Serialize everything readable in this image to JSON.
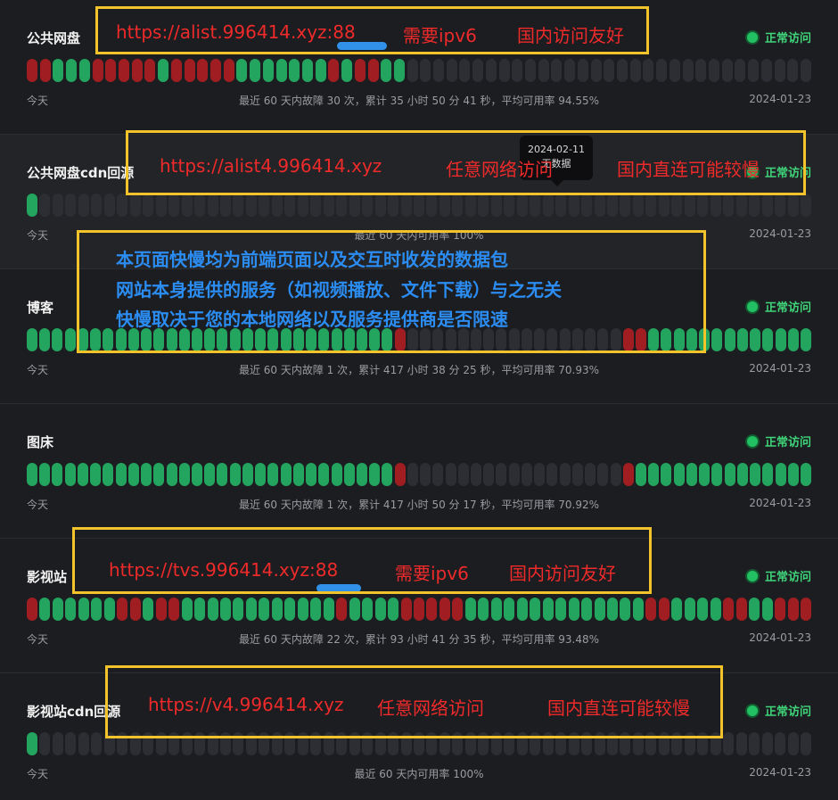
{
  "colors": {
    "up": "#23a45f",
    "down": "#a01e22",
    "nodata": "#2c2e33",
    "status": "#3fd47a",
    "annotation": "#ee2a2a",
    "note": "#2b8cf2",
    "box": "#f3c32b"
  },
  "monitors": [
    {
      "name": "公共网盘",
      "status": "正常访问",
      "today": "今天",
      "summary": "最近 60 天内故障 30 次，累计 35 小时 50 分 41 秒，平均可用率 94.55%",
      "date": "2024-01-23",
      "bars": "dduuuddddduddddduuuuuuududduuNNNNNNNNNNNNNNNNNNNNNNNNNNNNNNN"
    },
    {
      "name": "公共网盘cdn回源",
      "status": "正常访问",
      "today": "今天",
      "summary": "最近 60 天内可用率 100%",
      "date": "2024-01-23",
      "bars": "uNNNNNNNNNNNNNNNNNNNNNNNNNNNNNNNNNNNNNNNNNNNNNNNNNNNNNNNNNNNN"
    },
    {
      "name": "博客",
      "status": "正常访问",
      "today": "今天",
      "summary": "最近 60 天内故障 1 次，累计 417 小时 38 分 25 秒，平均可用率 70.93%",
      "date": "2024-01-23",
      "bars": "uuuuuuuuuuuuuuuuuuuuuuuuuuuuudNNNNNNNNNNNNNNNNNdduuuuuuuuuuuuu"
    },
    {
      "name": "图床",
      "status": "正常访问",
      "today": "今天",
      "summary": "最近 60 天内故障 1 次，累计 417 小时 50 分 17 秒，平均可用率 70.92%",
      "date": "2024-01-23",
      "bars": "uuuuuuuuuuuuuuuuuuuuuuuuuuuuudNNNNNNNNNNNNNNNNNduuuuuuuuuuuuuu"
    },
    {
      "name": "影视站",
      "status": "正常访问",
      "today": "今天",
      "summary": "最近 60 天内故障 22 次，累计 93 小时 41 分 35 秒，平均可用率 93.48%",
      "date": "2024-01-23",
      "bars": "duuuuuuddudduuuuuuuuuuuuduuuuddddduuuuuuuuuuuuuudduuuudduuddd"
    },
    {
      "name": "影视站cdn回源",
      "status": "正常访问",
      "today": "今天",
      "summary": "最近 60 天内可用率 100%",
      "date": "2024-01-23",
      "bars": "uNNNNNNNNNNNNNNNNNNNNNNNNNNNNNNNNNNNNNNNNNNNNNNNNNNNNNNNNNNNN"
    }
  ],
  "tooltip": {
    "date": "2024-02-11",
    "text": "无数据"
  },
  "annotations": {
    "box1": {
      "url": "https://alist.996414.xyz:88",
      "req": "需要ipv6",
      "note": "国内访问友好"
    },
    "box2": {
      "url": "https://alist4.996414.xyz",
      "req": "任意网络访问",
      "note": "国内直连可能较慢"
    },
    "box3": {
      "line1": "本页面快慢均为前端页面以及交互时收发的数据包",
      "line2": "网站本身提供的服务（如视频播放、文件下载）与之无关",
      "line3": "快慢取决于您的本地网络以及服务提供商是否限速"
    },
    "box4": {
      "url": "https://tvs.996414.xyz:88",
      "req": "需要ipv6",
      "note": "国内访问友好"
    },
    "box5": {
      "url": "https://v4.996414.xyz",
      "req": "任意网络访问",
      "note": "国内直连可能较慢"
    }
  }
}
